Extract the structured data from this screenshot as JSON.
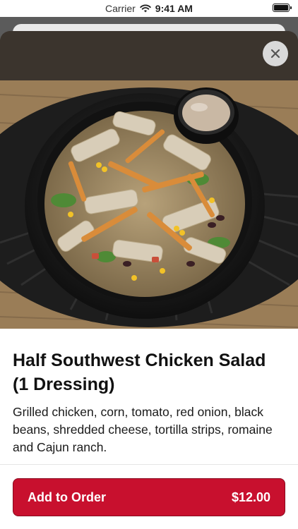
{
  "status_bar": {
    "carrier": "Carrier",
    "time": "9:41 AM",
    "wifi_icon": "wifi-icon",
    "battery_icon": "battery-icon"
  },
  "item": {
    "title": "Half Southwest Chicken Salad (1 Dressing)",
    "description": "Grilled chicken, corn, tomato, red onion, black beans, shredded cheese, tortilla strips, romaine and Cajun ranch.",
    "image_icon": "salad-photo"
  },
  "close_button": {
    "icon": "close-icon"
  },
  "add_to_order": {
    "label": "Add to Order",
    "price": "$12.00"
  },
  "colors": {
    "accent": "#c8102e",
    "backdrop": "#5b5b5b"
  }
}
